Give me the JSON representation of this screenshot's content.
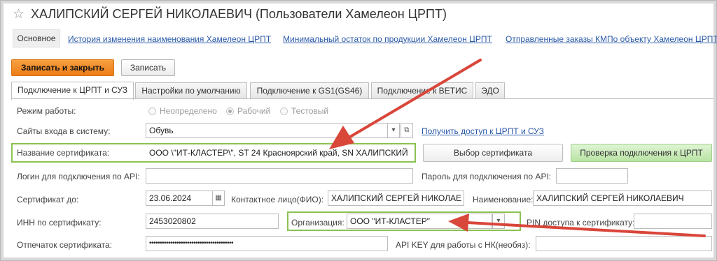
{
  "window": {
    "title": "ХАЛИПСКИЙ СЕРГЕЙ НИКОЛАЕВИЧ (Пользователи Хамелеон ЦРПТ)"
  },
  "nav": {
    "main": "Основное",
    "links": [
      "История изменения наименования Хамелеон ЦРПТ",
      "Минимальный остаток по продукции Хамелеон ЦРПТ",
      "Отправленные заказы КМПо объекту Хамелеон ЦРПТ"
    ]
  },
  "toolbar": {
    "save_close": "Записать и закрыть",
    "save": "Записать"
  },
  "tabs": [
    "Подключение к ЦРПТ и СУЗ",
    "Настройки по умолчанию",
    "Подключение к GS1(GS46)",
    "Подключение к ВЕТИС",
    "ЭДО"
  ],
  "form": {
    "mode_label": "Режим работы:",
    "mode_options": [
      "Неопределено",
      "Рабочий",
      "Тестовый"
    ],
    "mode_selected": "Рабочий",
    "sites_label": "Сайты входа в систему:",
    "sites_value": "Обувь",
    "access_link": "Получить доступ к ЦРПТ и СУЗ",
    "cert_name_label": "Название сертификата:",
    "cert_name_value": "ООО \\\"ИТ-КЛАСТЕР\\\", ST 24 Красноярский край, SN ХАЛИПСКИЙ",
    "choose_cert": "Выбор сертификата",
    "check_conn": "Проверка подключения к ЦРПТ",
    "login_label": "Логин для подключения по API:",
    "login_value": "",
    "password_label": "Пароль для подключения по API:",
    "password_value": "",
    "cert_until_label": "Сертификат до:",
    "cert_until_value": "23.06.2024",
    "contact_label": "Контактное лицо(ФИО):",
    "contact_value": "ХАЛИПСКИЙ СЕРГЕЙ НИКОЛАЕ",
    "name_label": "Наименование:",
    "name_value": "ХАЛИПСКИЙ СЕРГЕЙ НИКОЛАЕВИЧ",
    "inn_label": "ИНН по сертификату:",
    "inn_value": "2453020802",
    "org_label": "Организация:",
    "org_value": "ООО \"ИТ-КЛАСТЕР\"",
    "pin_label": "PIN доступа к сертификату:",
    "thumb_label": "Отпечаток сертификата:",
    "thumb_value": "••••••••••••••••••••••••••••••••••••••••",
    "apikey_label": "API KEY для работы с НК(необяз):"
  },
  "colors": {
    "arrow": "#d9463a",
    "highlight": "#8cc152",
    "primary": "#ec7d17",
    "link": "#2b5aa8"
  }
}
